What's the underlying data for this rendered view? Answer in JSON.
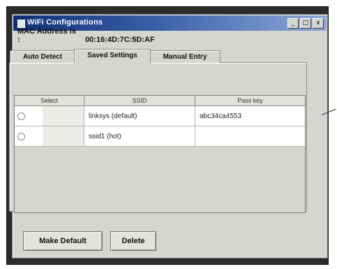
{
  "window": {
    "title": "WiFi Configurations",
    "controls": [
      "_",
      "□",
      "x"
    ]
  },
  "mac": {
    "label": "MAC Address is :",
    "value": "00:16:4D:7C:5D:AF"
  },
  "tabs": [
    {
      "label": "Auto Detect",
      "active": false
    },
    {
      "label": "Saved Settings",
      "active": true
    },
    {
      "label": "Manual Entry",
      "active": false
    }
  ],
  "table": {
    "columns": [
      "Select",
      "SSID",
      "Pass key"
    ],
    "rows": [
      {
        "ssid": "linksys (default)",
        "passkey": "abc34ca4553"
      },
      {
        "ssid": "ssid1 (hot)",
        "passkey": ""
      }
    ]
  },
  "buttons": {
    "make_default": "Make Default",
    "delete": "Delete"
  },
  "colors": {
    "title_start": "#0d2e73",
    "title_end": "#8da9d8",
    "window_bg": "#d6d5cf"
  }
}
